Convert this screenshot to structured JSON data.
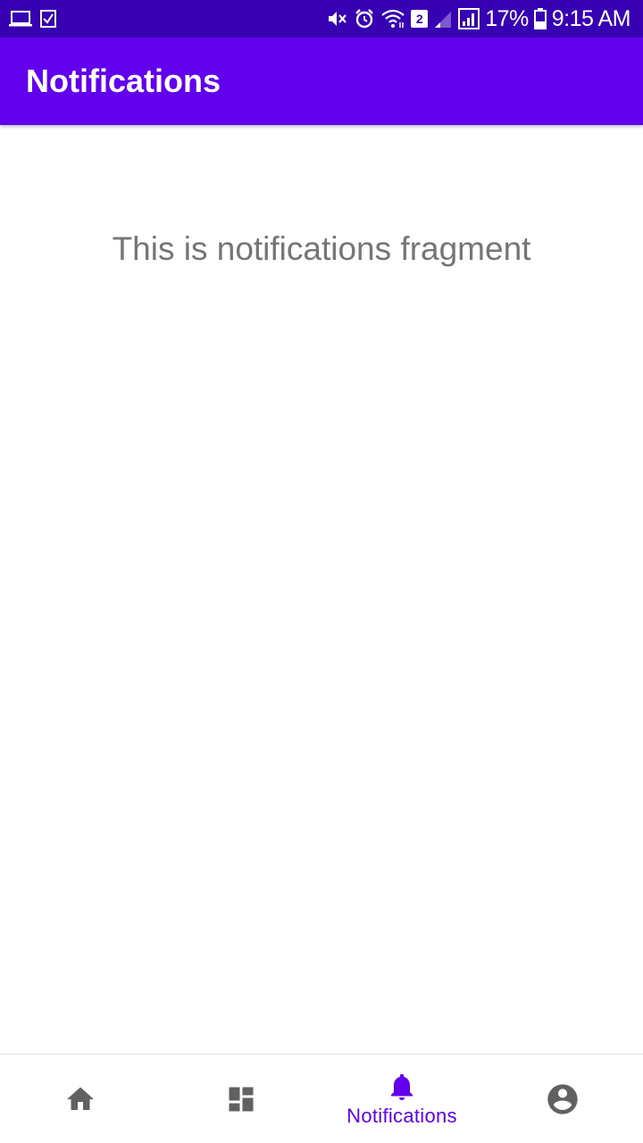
{
  "status_bar": {
    "left_icons": [
      "laptop-icon",
      "checkbox-icon"
    ],
    "right_icons": [
      "mute-icon",
      "alarm-icon",
      "wifi-icon",
      "sim-2-icon",
      "signal-weak-icon",
      "signal-icon",
      "battery-icon"
    ],
    "sim_number": "2",
    "battery": "17%",
    "time": "9:15 AM"
  },
  "app_bar": {
    "title": "Notifications",
    "color": "#6200ee"
  },
  "main": {
    "text": "This is notifications fragment"
  },
  "bottom_nav": {
    "items": [
      {
        "icon": "home-icon",
        "label": "",
        "selected": false
      },
      {
        "icon": "dashboard-icon",
        "label": "",
        "selected": false
      },
      {
        "icon": "bell-icon",
        "label": "Notifications",
        "selected": true
      },
      {
        "icon": "account-icon",
        "label": "",
        "selected": false
      }
    ],
    "active_color": "#6200ee",
    "inactive_color": "#616161"
  },
  "colors": {
    "status_bar": "#3700b3",
    "primary": "#6200ee",
    "text_secondary": "#757575"
  }
}
